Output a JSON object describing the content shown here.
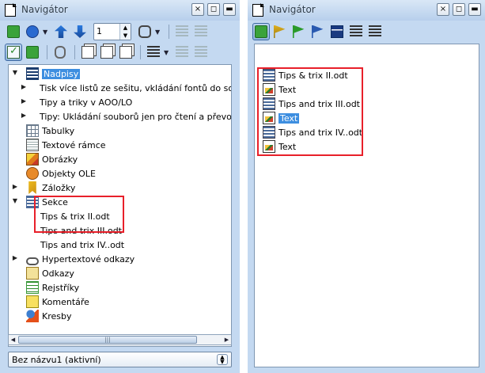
{
  "left": {
    "title": "Navigátor",
    "spin_value": "1",
    "tree": {
      "headings": "Nadpisy",
      "heading_children": [
        "Tisk více listů ze sešitu, vkládání fontů do soubor",
        "Tipy a triky v AOO/LO",
        "Tipy: Ukládání souborů jen pro čtení a převod tex"
      ],
      "tables": "Tabulky",
      "text_frames": "Textové rámce",
      "images": "Obrázky",
      "ole": "Objekty OLE",
      "bookmarks": "Záložky",
      "sections": "Sekce",
      "section_children": [
        "Tips & trix II.odt",
        "Tips and trix III.odt",
        "Tips and trix IV..odt"
      ],
      "hyperlinks": "Hypertextové odkazy",
      "references": "Odkazy",
      "indexes": "Rejstříky",
      "comments": "Komentáře",
      "drawings": "Kresby"
    },
    "document_select": "Bez názvu1 (aktivní)"
  },
  "right": {
    "title": "Navigátor",
    "items": [
      {
        "label": "Tips & trix II.odt",
        "icon": "document-icon"
      },
      {
        "label": "Text",
        "icon": "text-icon"
      },
      {
        "label": "Tips and trix III.odt",
        "icon": "document-icon"
      },
      {
        "label": "Text",
        "icon": "text-icon"
      },
      {
        "label": "Tips and trix IV..odt",
        "icon": "document-icon"
      },
      {
        "label": "Text",
        "icon": "text-icon"
      }
    ]
  },
  "titlebar_buttons": {
    "close": "×",
    "restore": "◻",
    "minimize": "▬"
  },
  "colors": {
    "highlight": "#e8202a",
    "selection": "#3d8ee0",
    "window": "#c4d9f1"
  }
}
